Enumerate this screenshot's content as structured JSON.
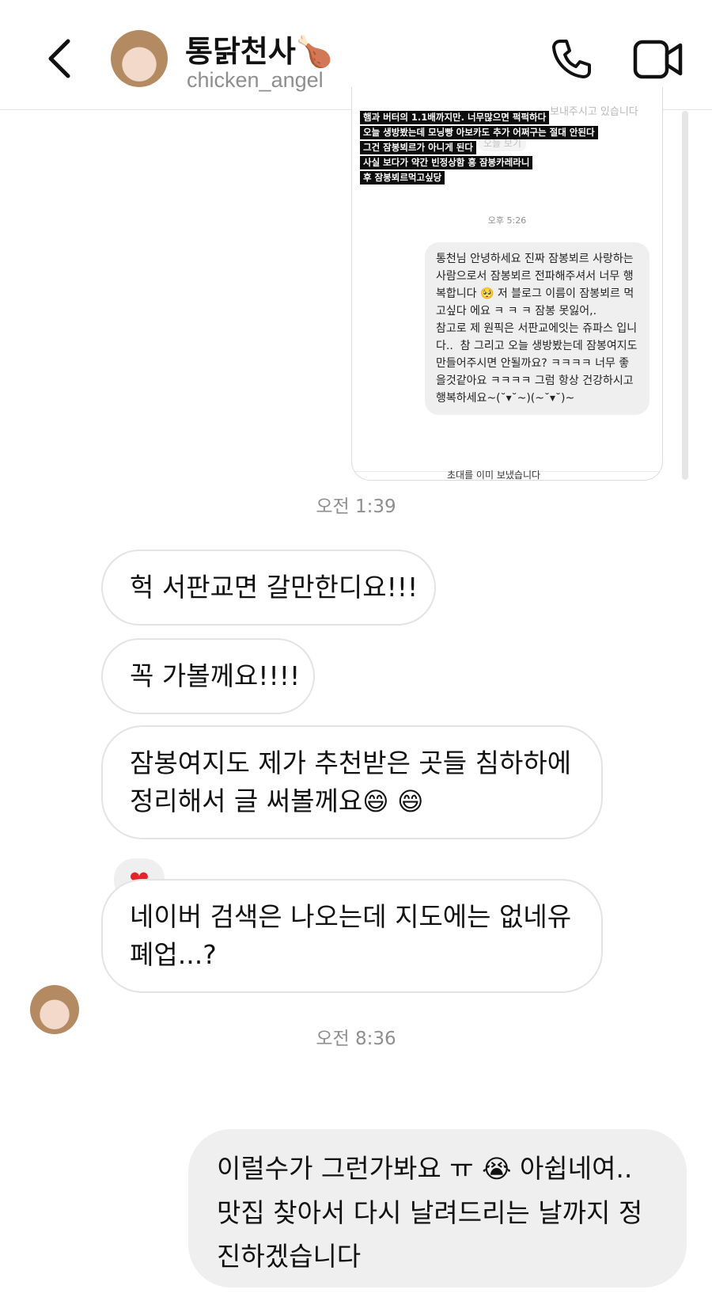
{
  "header": {
    "contact_name": "통닭천사",
    "contact_name_emoji": "🍗",
    "handle": "chicken_angel",
    "icons": [
      "back-arrow-icon",
      "phone-icon",
      "video-call-icon"
    ]
  },
  "shared_screenshot": {
    "captions": [
      "햄과 버터의 1.1배까지만. 너무많으면 퍽퍽하다",
      "오늘 생방봤는데 모닝빵 아보카도 추가 어쩌구는 절대 안된다",
      "그건 잠봉뵈르가 아니게 된다",
      "사실 보다가 약간 빈정상함 흥 잠봉카레라니",
      "후 잠봉뵈르먹고싶당"
    ],
    "faded_top": "보내주시고 있습니다",
    "faded_mid": "오늘 보기",
    "time": "오후 5:26",
    "message": "통천님 안녕하세요 진짜 잠봉뵈르 사랑하는 사람으로서 잠봉뵈르 전파해주셔서 너무 행복합니다 🥺 저 블로그 이름이 잠봉뵈르 먹고싶다 에요 ㅋ ㅋ ㅋ 잠봉 못잃어,.\n참고로 제 원픽은 서판교에잇는 쥬파스 입니다..  참 그리고 오늘 생방봤는데 잠봉여지도 만들어주시면 안될까요? ㅋㅋㅋㅋ 너무 좋을것같아요 ㅋㅋㅋㅋ 그럼 항상 건강하시고 행복하세요~(˘▾˘~)(~˘▾˘)~",
    "footer_text": "초대를 이미 보냈습니다"
  },
  "time_1": "오전 1:39",
  "incoming": [
    "헉 서판교면 갈만한디요!!!",
    "꼭 가볼께요!!!!",
    "잠봉여지도 제가 추천받은 곳들 침하하에",
    "정리해서 글 써볼께요",
    "😄",
    "😄",
    "네이버 검색은 나오는데 지도에는 없네유",
    "폐업...?"
  ],
  "reaction": "❤",
  "time_2": "오전 8:36",
  "outgoing": {
    "line1_text": "이럴수가 그런가봐요 ㅠ",
    "line1_emoji": "😭",
    "line1_tail": "아쉽네여..",
    "line2": "맛집 찾아서 다시 날려드리는 날까지 정",
    "line3": "진하겠습니다"
  }
}
